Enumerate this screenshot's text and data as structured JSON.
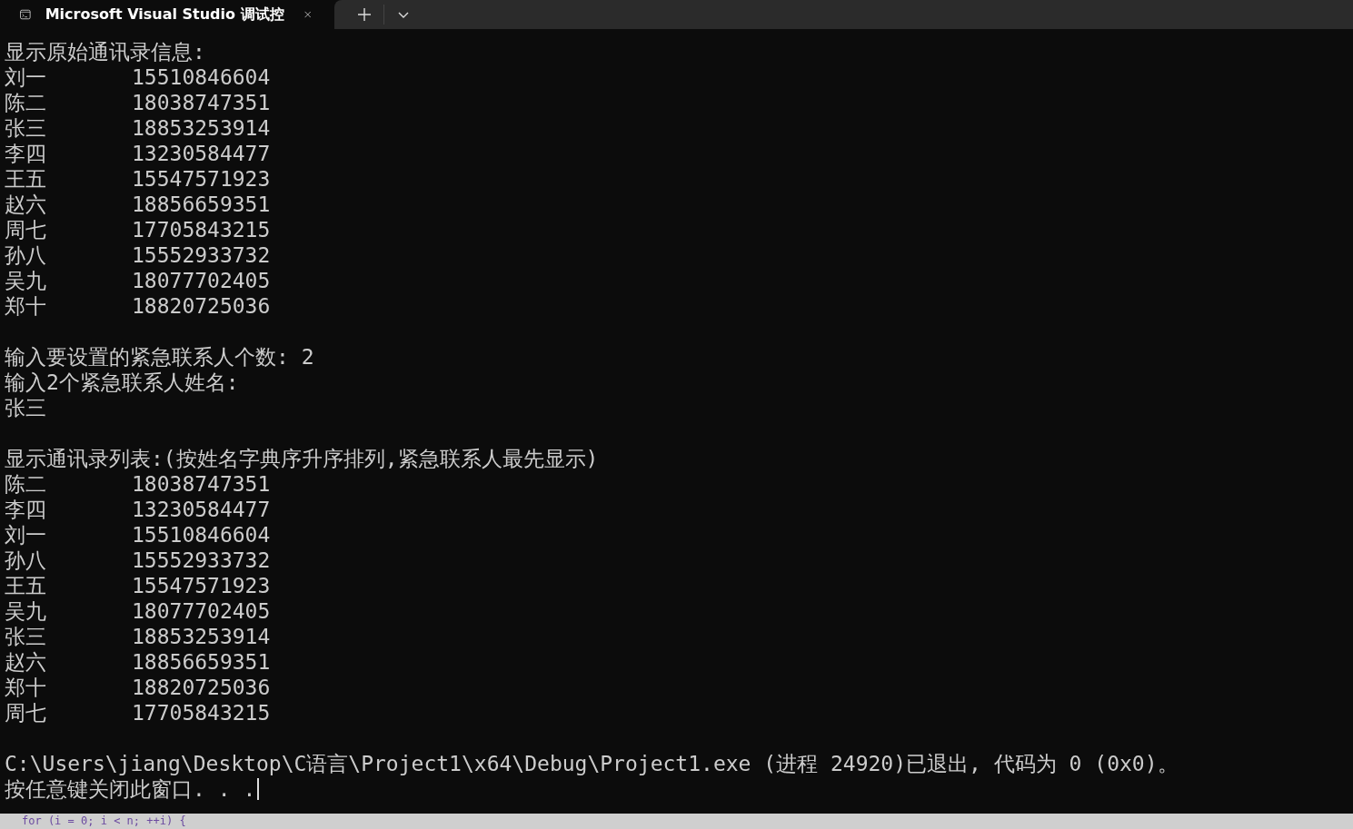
{
  "tab": {
    "title": "Microsoft Visual Studio 调试控",
    "selected": true
  },
  "terminal": {
    "cursor": true,
    "lines": [
      {
        "kind": "text",
        "text": "显示原始通讯录信息:"
      },
      {
        "kind": "entry",
        "name": "刘一",
        "number": "15510846604"
      },
      {
        "kind": "entry",
        "name": "陈二",
        "number": "18038747351"
      },
      {
        "kind": "entry",
        "name": "张三",
        "number": "18853253914"
      },
      {
        "kind": "entry",
        "name": "李四",
        "number": "13230584477"
      },
      {
        "kind": "entry",
        "name": "王五",
        "number": "15547571923"
      },
      {
        "kind": "entry",
        "name": "赵六",
        "number": "18856659351"
      },
      {
        "kind": "entry",
        "name": "周七",
        "number": "17705843215"
      },
      {
        "kind": "entry",
        "name": "孙八",
        "number": "15552933732"
      },
      {
        "kind": "entry",
        "name": "吴九",
        "number": "18077702405"
      },
      {
        "kind": "entry",
        "name": "郑十",
        "number": "18820725036"
      },
      {
        "kind": "blank"
      },
      {
        "kind": "text",
        "text": "输入要设置的紧急联系人个数: 2"
      },
      {
        "kind": "text",
        "text": "输入2个紧急联系人姓名:"
      },
      {
        "kind": "text",
        "text": "张三"
      },
      {
        "kind": "blank"
      },
      {
        "kind": "text",
        "text": "显示通讯录列表:(按姓名字典序升序排列,紧急联系人最先显示)"
      },
      {
        "kind": "entry",
        "name": "陈二",
        "number": "18038747351"
      },
      {
        "kind": "entry",
        "name": "李四",
        "number": "13230584477"
      },
      {
        "kind": "entry",
        "name": "刘一",
        "number": "15510846604"
      },
      {
        "kind": "entry",
        "name": "孙八",
        "number": "15552933732"
      },
      {
        "kind": "entry",
        "name": "王五",
        "number": "15547571923"
      },
      {
        "kind": "entry",
        "name": "吴九",
        "number": "18077702405"
      },
      {
        "kind": "entry",
        "name": "张三",
        "number": "18853253914"
      },
      {
        "kind": "entry",
        "name": "赵六",
        "number": "18856659351"
      },
      {
        "kind": "entry",
        "name": "郑十",
        "number": "18820725036"
      },
      {
        "kind": "entry",
        "name": "周七",
        "number": "17705843215"
      },
      {
        "kind": "blank"
      },
      {
        "kind": "text",
        "text": "C:\\Users\\jiang\\Desktop\\C语言\\Project1\\x64\\Debug\\Project1.exe (进程 24920)已退出, 代码为 0 (0x0)。"
      },
      {
        "kind": "text",
        "text": "按任意键关闭此窗口. . ."
      }
    ]
  },
  "editor_behind": {
    "code": "for (i = 0; i < n; ++i) {"
  }
}
